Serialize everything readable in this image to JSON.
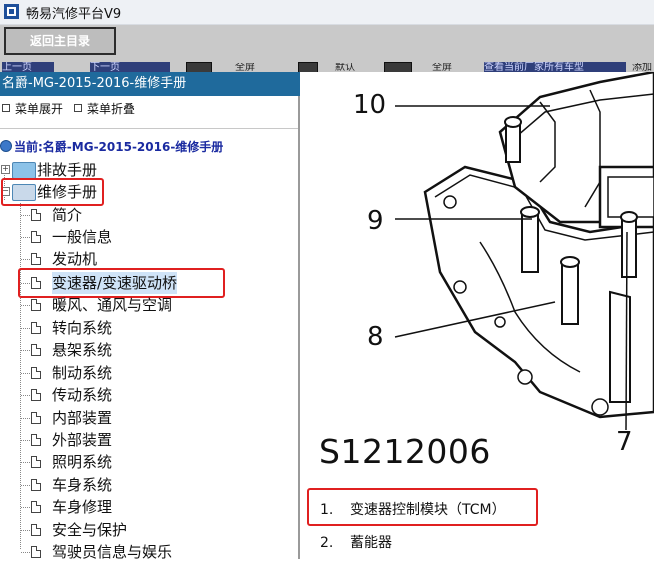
{
  "titlebar": {
    "title": "畅易汽修平台V9"
  },
  "toolbar": {
    "return_label": "返回主目录",
    "partial": {
      "p1": "上一页",
      "p2": "下一页",
      "p3": "全屏",
      "p4": "默认",
      "p5": "全屏",
      "p6": "查看当前厂家所有车型",
      "p7": "添加"
    }
  },
  "left": {
    "header": "名爵-MG-2015-2016-维修手册",
    "expand": "菜单展开",
    "collapse": "菜单折叠",
    "current": "当前:名爵-MG-2015-2016-维修手册",
    "nodes": [
      "排故手册",
      "维修手册"
    ],
    "items": [
      "简介",
      "一般信息",
      "发动机",
      "变速器/变速驱动桥",
      "暖风、通风与空调",
      "转向系统",
      "悬架系统",
      "制动系统",
      "传动系统",
      "内部装置",
      "外部装置",
      "照明系统",
      "车身系统",
      "车身修理",
      "安全与保护",
      "驾驶员信息与娱乐"
    ]
  },
  "figure": {
    "callouts": [
      "10",
      "9",
      "8",
      "7"
    ],
    "code": "S1212006",
    "legend": [
      {
        "num": "1.",
        "text": "变速器控制模块（TCM）"
      },
      {
        "num": "2.",
        "text": "蓄能器"
      }
    ]
  },
  "colors": {
    "header_blue": "#1f6a9c",
    "highlight_red": "#e02020",
    "selection": "#cfe3f7"
  }
}
